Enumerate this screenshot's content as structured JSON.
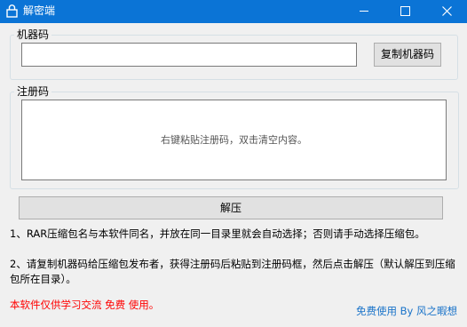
{
  "window": {
    "title": "解密端",
    "accent": "#0b74d6"
  },
  "machine_group": {
    "label": "机器码",
    "input_value": "",
    "copy_button": "复制机器码"
  },
  "register_group": {
    "label": "注册码",
    "placeholder_hint": "右键粘贴注册码，双击清空内容。"
  },
  "unpack_button": "解压",
  "notes": {
    "line1": "1、RAR压缩包名与本软件同名，并放在同一目录里就会自动选择；否则请手动选择压缩包。",
    "line2": "2、请复制机器码给压缩包发布者，获得注册码后粘贴到注册码框，然后点击解压（默认解压到压缩包所在目录）。",
    "disclaimer": "本软件仅供学习交流  免费  使用。"
  },
  "footer_link": "免费使用 By 风之暇想"
}
